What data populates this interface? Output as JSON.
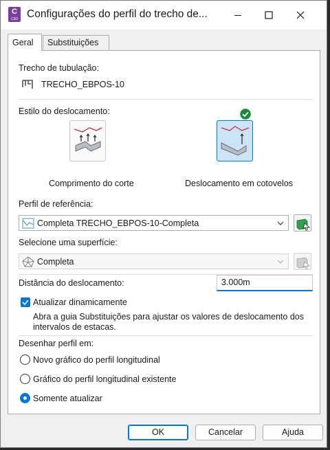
{
  "window": {
    "title": "Configurações do perfil do trecho de...",
    "app_icon": {
      "letter": "C",
      "sub": "C3D"
    }
  },
  "tabs": [
    {
      "label": "Geral",
      "active": true
    },
    {
      "label": "Substituições",
      "active": false
    }
  ],
  "general": {
    "run_label": "Trecho de tubulação:",
    "run_name": "TRECHO_EBPOS-10",
    "offset_style_label": "Estilo do deslocamento:",
    "offset_options": [
      {
        "label": "Comprimento do corte",
        "selected": false
      },
      {
        "label": "Deslocamento em cotovelos",
        "selected": true
      }
    ],
    "ref_profile_label": "Perfil de referência:",
    "ref_profile_value": "Completa TRECHO_EBPOS-10-Completa",
    "surface_label": "Selecione uma superfície:",
    "surface_value": "Completa",
    "offset_distance_label": "Distância do deslocamento:",
    "offset_distance_value": "3.000m",
    "dynamic_update_label": "Atualizar dinamicamente",
    "dynamic_update_checked": true,
    "dynamic_update_note": "Abra a guia Substituições para ajustar os valores de deslocamento dos intervalos de estacas.",
    "draw_profile_label": "Desenhar perfil em:",
    "draw_options": [
      {
        "label": "Novo gráfico do perfil longitudinal",
        "selected": false
      },
      {
        "label": "Gráfico do perfil longitudinal existente",
        "selected": false
      },
      {
        "label": "Somente atualizar",
        "selected": true
      }
    ]
  },
  "buttons": {
    "ok": "OK",
    "cancel": "Cancelar",
    "help": "Ajuda"
  },
  "colors": {
    "accent": "#0078d4",
    "check_badge": "#1e8a3a",
    "app_icon": "#7b3fa0"
  }
}
